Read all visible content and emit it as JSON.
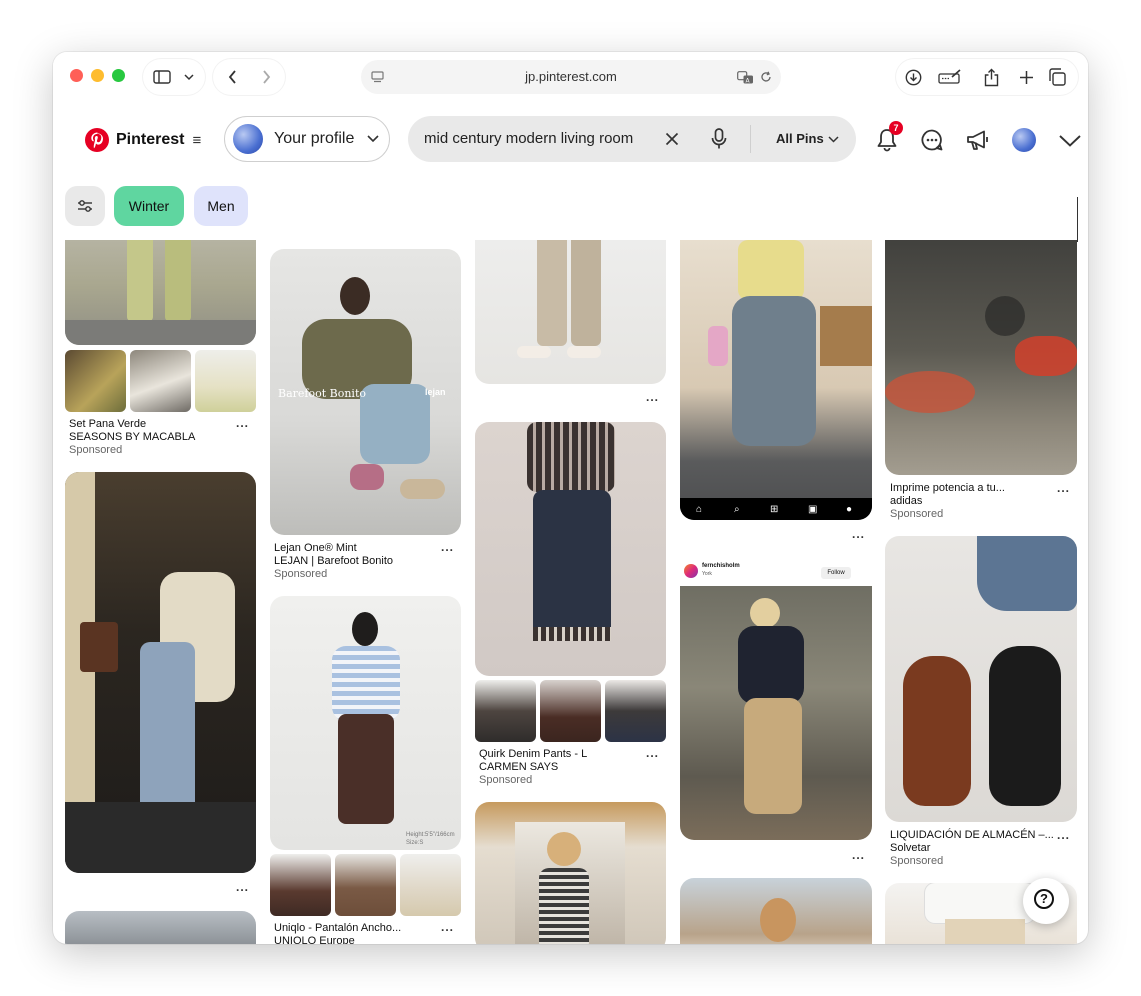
{
  "browser": {
    "url": "jp.pinterest.com",
    "traffic_lights": {
      "close": "#ff5f57",
      "minimize": "#febc2e",
      "zoom": "#28c840"
    },
    "icons": [
      "sidebar-icon",
      "chevron-down-icon",
      "back-icon",
      "forward-icon",
      "page-icon",
      "translate-icon",
      "reload-icon",
      "download-icon",
      "edit-icon",
      "share-icon",
      "new-tab-icon",
      "tabs-icon"
    ]
  },
  "header": {
    "logo_text": "Pinterest",
    "profile_label": "Your profile",
    "search_value": "mid century modern living room",
    "search_scope": "All Pins",
    "notification_count": "7",
    "brand_color": "#e60023"
  },
  "filters": {
    "chips": [
      {
        "label": "Winter",
        "color": "#5fd6a0"
      },
      {
        "label": "Men",
        "color": "#dfe3fb"
      }
    ]
  },
  "pins": {
    "col1": [
      {
        "title": "Set Pana Verde",
        "brand": "SEASONS BY MACABLA",
        "sponsored": "Sponsored"
      }
    ],
    "col2": [
      {
        "title": "Lejan One® Mint",
        "brand": "LEJAN | Barefoot Bonito",
        "sponsored": "Sponsored",
        "overlay_left": "Barefoot Bonito",
        "overlay_right": "lejan"
      },
      {
        "title": "Uniqlo - Pantalón Ancho...",
        "brand": "UNIQLO Europe",
        "size_note": "Height:5'5\"/166cm Size:S"
      }
    ],
    "col3": [
      {
        "title": "Quirk Denim Pants - L",
        "brand": "CARMEN SAYS",
        "sponsored": "Sponsored"
      }
    ],
    "col4": [
      {
        "account": "fernchisholm",
        "location": "York",
        "follow": "Follow"
      }
    ],
    "col5": [
      {
        "title": "Imprime potencia a tu...",
        "brand": "adidas",
        "sponsored": "Sponsored"
      },
      {
        "title": "LIQUIDACIÓN DE ALMACÉN –...",
        "brand": "Solvetar",
        "sponsored": "Sponsored"
      }
    ],
    "more_label": "..."
  },
  "help_label": "?"
}
